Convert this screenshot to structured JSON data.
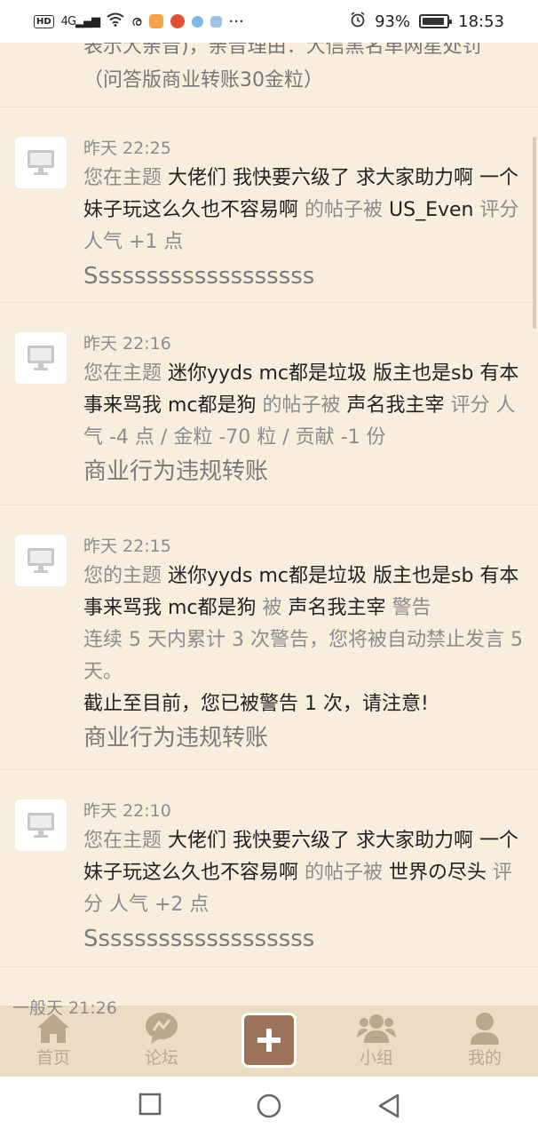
{
  "status_bar": {
    "network": "4G",
    "battery": "93%",
    "time": "18:53",
    "icons": [
      "hd-icon",
      "signal-icon",
      "wifi-icon",
      "weibo-icon",
      "app-icon",
      "app-icon",
      "app-icon",
      "more-icon",
      "alarm-icon",
      "battery-icon"
    ]
  },
  "partial_top": {
    "line1": "表示大亲音)，亲音理由：大信黑名单网星处罚",
    "line2": "（问答版商业转账30金粒）"
  },
  "notifications": [
    {
      "time": "昨天 22:25",
      "prefix": "您在主题",
      "topic": "大佬们 我快要六级了 求大家助力啊 一个妹子玩这么久也不容易啊",
      "mid": "的帖子被",
      "user": "US_Even",
      "action": "评分 人气 +1 点",
      "reason": "Sssssssssssssssssss"
    },
    {
      "time": "昨天 22:16",
      "prefix": "您在主题",
      "topic": "迷你yyds mc都是垃圾 版主也是sb 有本事来骂我 mc都是狗",
      "mid": "的帖子被",
      "user": "声名我主宰",
      "action": "评分 人气 -4 点 / 金粒 -70 粒 / 贡献 -1 份",
      "reason": "商业行为违规转账"
    },
    {
      "time": "昨天 22:15",
      "prefix": "您的主题",
      "topic": "迷你yyds mc都是垃圾 版主也是sb 有本事来骂我 mc都是狗",
      "mid": "被",
      "user": "声名我主宰",
      "action": "警告",
      "note1": "连续 5 天内累计 3 次警告，您将被自动禁止发言 5 天。",
      "note2": "截止至目前，您已被警告 1 次，请注意!",
      "reason": "商业行为违规转账"
    },
    {
      "time": "昨天 22:10",
      "prefix": "您在主题",
      "topic": "大佬们 我快要六级了 求大家助力啊 一个妹子玩这么久也不容易啊",
      "mid": "的帖子被",
      "user": "世界の尽头",
      "action": "评分 人气 +2 点",
      "reason": "Sssssssssssssssssss"
    }
  ],
  "peek_text": "一般天 21:26",
  "bottom_nav": {
    "home": "首页",
    "forum": "论坛",
    "add": "+",
    "group": "小组",
    "mine": "我的"
  },
  "colors": {
    "background": "#f9eedd",
    "nav_background": "#ecdcc4",
    "nav_label": "#b9a88e",
    "add_button": "#9c7358",
    "muted_text": "#8c8c8c"
  }
}
